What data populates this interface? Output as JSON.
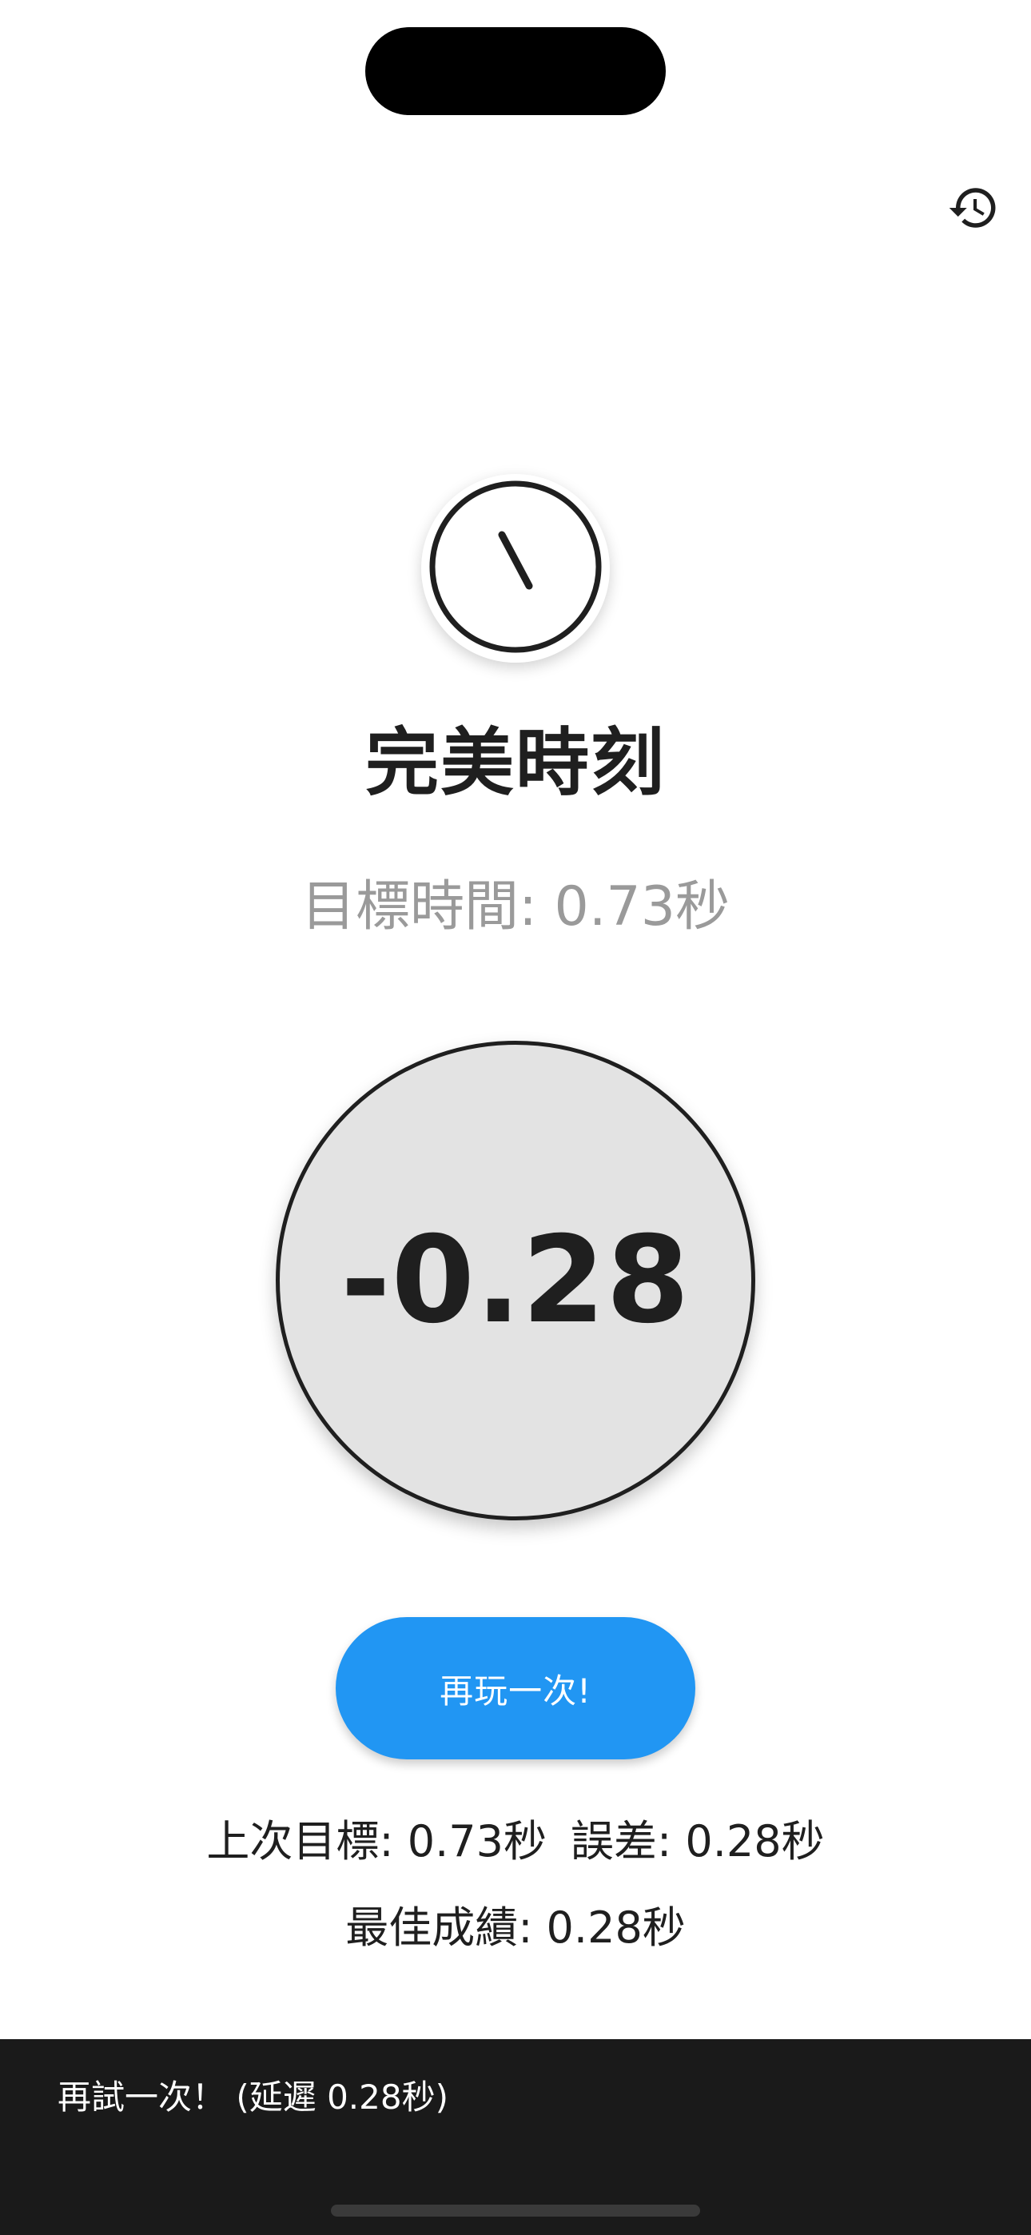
{
  "app": {
    "title": "完美時刻",
    "target_time": "目標時間: 0.73秒"
  },
  "icons": {
    "history": "history-icon",
    "logo": "clock-icon"
  },
  "tap_area": {
    "value": "-0.28"
  },
  "actions": {
    "play_again_label": "再玩一次!"
  },
  "stats": {
    "last_target": "上次目標: 0.73秒",
    "error": "誤差: 0.28秒",
    "best": "最佳成績: 0.28秒"
  },
  "snackbar": {
    "message": "再試一次！ (延遲 0.28秒)"
  },
  "colors": {
    "accent": "#2196f3",
    "circle_bg": "#e3e3e3",
    "snackbar_bg": "#1a1a1a",
    "muted_text": "#9a9a9a"
  }
}
